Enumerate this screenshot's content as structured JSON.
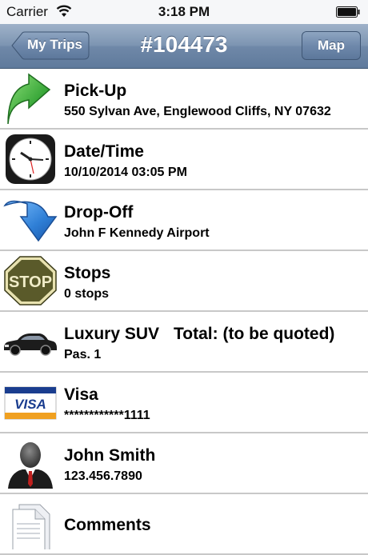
{
  "status_bar": {
    "carrier": "Carrier",
    "time": "3:18 PM"
  },
  "nav": {
    "back_label": "My Trips",
    "title": "#104473",
    "map_label": "Map"
  },
  "rows": [
    {
      "title": "Pick-Up",
      "subtitle": "550 Sylvan Ave, Englewood Cliffs, NY 07632",
      "icon": "green-up-arrow-icon"
    },
    {
      "title": "Date/Time",
      "subtitle": "10/10/2014 03:05 PM",
      "icon": "clock-icon"
    },
    {
      "title": "Drop-Off",
      "subtitle": "John F Kennedy Airport",
      "icon": "blue-down-arrow-icon"
    },
    {
      "title": "Stops",
      "subtitle": "0 stops",
      "icon": "stop-sign-icon",
      "icon_text": "STOP"
    },
    {
      "title": "Luxury SUV",
      "total": "Total: (to be quoted)",
      "subtitle": "Pas. 1",
      "icon": "car-icon"
    },
    {
      "title": "Visa",
      "subtitle": "************1111",
      "icon": "visa-card-icon",
      "icon_text": "VISA"
    },
    {
      "title": "John Smith",
      "subtitle": "123.456.7890",
      "icon": "person-icon"
    },
    {
      "title": "Comments",
      "icon": "document-icon"
    }
  ],
  "colors": {
    "nav_bar": "#6f88a8",
    "green_arrow": "#3aa83a",
    "blue_arrow": "#2f7fd6",
    "stop_sign": "#5a5a2a"
  }
}
